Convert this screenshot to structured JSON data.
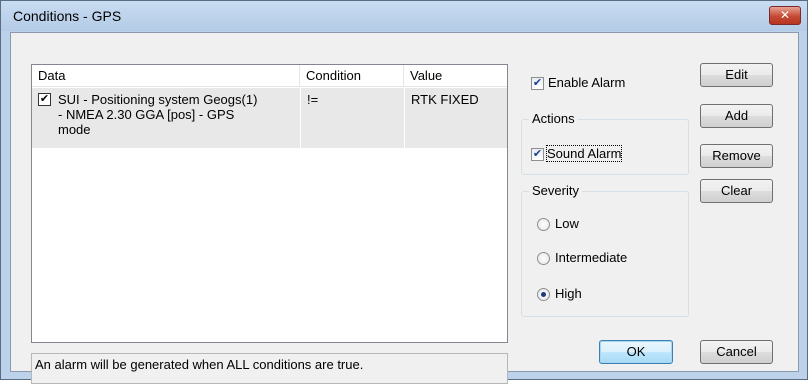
{
  "window": {
    "title": "Conditions - GPS",
    "close_glyph": "✕"
  },
  "list": {
    "columns": [
      "Data",
      "Condition",
      "Value"
    ],
    "rows": [
      {
        "checked": true,
        "data_lines": [
          "SUI - Positioning system Geogs(1)",
          "- NMEA 2.30 GGA [pos] - GPS",
          "mode"
        ],
        "condition": "!=",
        "value": "RTK FIXED"
      }
    ]
  },
  "status_text": "An alarm will be generated when ALL conditions are true.",
  "enable_alarm": {
    "label": "Enable Alarm",
    "checked": true
  },
  "actions": {
    "title": "Actions",
    "sound_alarm": {
      "label": "Sound Alarm",
      "checked": true
    }
  },
  "severity": {
    "title": "Severity",
    "options": [
      {
        "label": "Low",
        "selected": false
      },
      {
        "label": "Intermediate",
        "selected": false
      },
      {
        "label": "High",
        "selected": true
      }
    ]
  },
  "buttons": {
    "edit": "Edit",
    "add": "Add",
    "remove": "Remove",
    "clear": "Clear",
    "ok": "OK",
    "cancel": "Cancel"
  },
  "check_glyph": "✔"
}
